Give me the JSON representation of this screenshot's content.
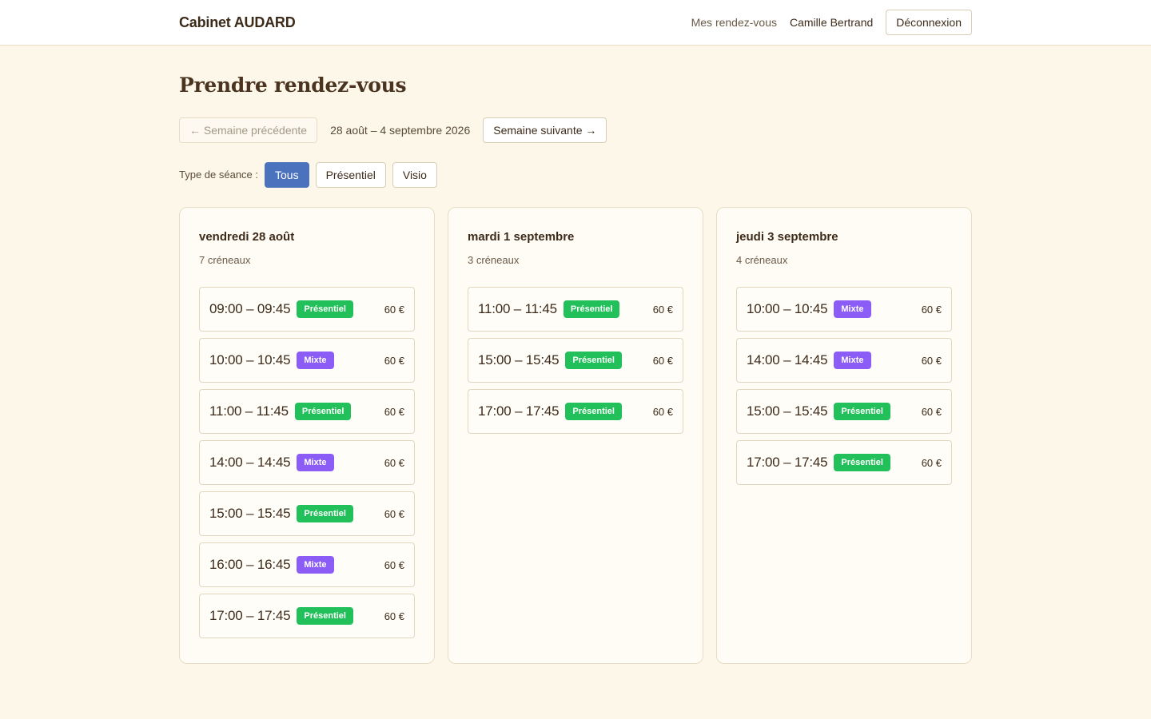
{
  "header": {
    "brand": "Cabinet AUDARD",
    "nav_appointments": "Mes rendez-vous",
    "user_name": "Camille Bertrand",
    "logout_label": "Déconnexion"
  },
  "page": {
    "title": "Prendre rendez-vous"
  },
  "week_nav": {
    "prev_label": "← Semaine précédente",
    "range_label": "28 août – 4 septembre 2026",
    "next_label": "Semaine suivante →"
  },
  "filters": {
    "label": "Type de séance :",
    "options": [
      "Tous",
      "Présentiel",
      "Visio"
    ],
    "selected": "Tous"
  },
  "colors": {
    "accent": "#4a72bd",
    "presentiel": "#22c05a",
    "mixte": "#8b5cf6",
    "background": "#fdf7ea"
  },
  "days": [
    {
      "title": "vendredi 28 août",
      "count": "7 créneaux",
      "slots": [
        {
          "time": "09:00 – 09:45",
          "type": "Présentiel",
          "price": "60 €"
        },
        {
          "time": "10:00 – 10:45",
          "type": "Mixte",
          "price": "60 €"
        },
        {
          "time": "11:00 – 11:45",
          "type": "Présentiel",
          "price": "60 €"
        },
        {
          "time": "14:00 – 14:45",
          "type": "Mixte",
          "price": "60 €"
        },
        {
          "time": "15:00 – 15:45",
          "type": "Présentiel",
          "price": "60 €"
        },
        {
          "time": "16:00 – 16:45",
          "type": "Mixte",
          "price": "60 €"
        },
        {
          "time": "17:00 – 17:45",
          "type": "Présentiel",
          "price": "60 €"
        }
      ]
    },
    {
      "title": "mardi 1 septembre",
      "count": "3 créneaux",
      "slots": [
        {
          "time": "11:00 – 11:45",
          "type": "Présentiel",
          "price": "60 €"
        },
        {
          "time": "15:00 – 15:45",
          "type": "Présentiel",
          "price": "60 €"
        },
        {
          "time": "17:00 – 17:45",
          "type": "Présentiel",
          "price": "60 €"
        }
      ]
    },
    {
      "title": "jeudi 3 septembre",
      "count": "4 créneaux",
      "slots": [
        {
          "time": "10:00 – 10:45",
          "type": "Mixte",
          "price": "60 €"
        },
        {
          "time": "14:00 – 14:45",
          "type": "Mixte",
          "price": "60 €"
        },
        {
          "time": "15:00 – 15:45",
          "type": "Présentiel",
          "price": "60 €"
        },
        {
          "time": "17:00 – 17:45",
          "type": "Présentiel",
          "price": "60 €"
        }
      ]
    }
  ]
}
